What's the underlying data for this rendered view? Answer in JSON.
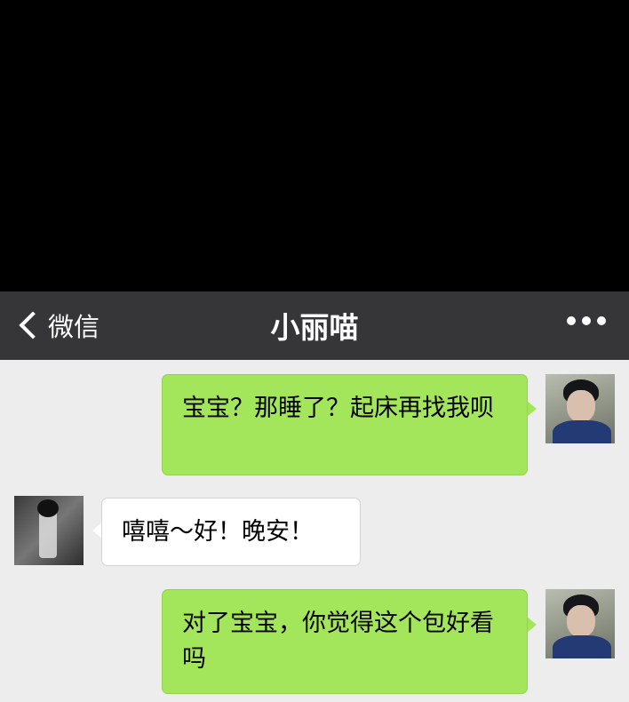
{
  "header": {
    "back_label": "微信",
    "title": "小丽喵"
  },
  "messages": [
    {
      "sender": "me",
      "text": "宝宝？那睡了？起床再找我呗"
    },
    {
      "sender": "contact",
      "text": "嘻嘻～好！晚安！"
    },
    {
      "sender": "me",
      "text": "对了宝宝，你觉得这个包好看吗"
    }
  ],
  "colors": {
    "navbar": "#363638",
    "chat_bg": "#ededed",
    "my_bubble": "#a4e65b",
    "their_bubble": "#ffffff"
  },
  "icons": {
    "back": "chevron-left-icon",
    "more": "more-dots-icon"
  }
}
